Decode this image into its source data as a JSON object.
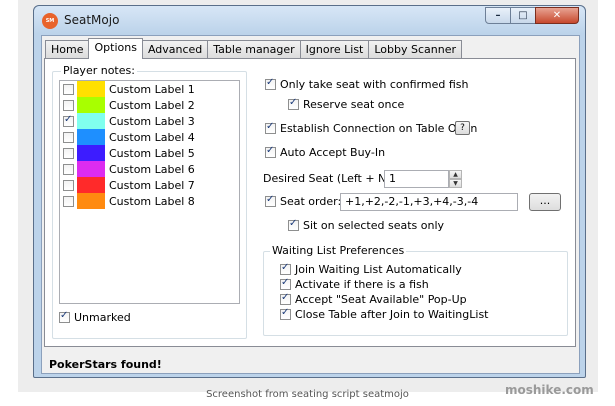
{
  "window": {
    "title": "SeatMojo",
    "icon_text": "SM"
  },
  "tabs": [
    "Home",
    "Options",
    "Advanced",
    "Table manager",
    "Ignore List",
    "Lobby Scanner"
  ],
  "player_notes": {
    "title": "Player notes:",
    "items": [
      {
        "label": "Custom Label 1",
        "color": "#ffe000",
        "checked": false
      },
      {
        "label": "Custom Label 2",
        "color": "#a8ff00",
        "checked": false
      },
      {
        "label": "Custom Label 3",
        "color": "#80ffee",
        "checked": true
      },
      {
        "label": "Custom Label 4",
        "color": "#1e8fff",
        "checked": false
      },
      {
        "label": "Custom Label 5",
        "color": "#3d1cff",
        "checked": false
      },
      {
        "label": "Custom Label 6",
        "color": "#dc2cf0",
        "checked": false
      },
      {
        "label": "Custom Label 7",
        "color": "#ff2a2a",
        "checked": false
      },
      {
        "label": "Custom Label 8",
        "color": "#ff8a10",
        "checked": false
      }
    ],
    "unmarked_label": "Unmarked",
    "unmarked_checked": true
  },
  "options": {
    "only_confirmed_fish": "Only take seat with confirmed fish",
    "reserve_once": "Reserve seat once",
    "establish_connection": "Establish Connection on Table Open",
    "help_button": "?",
    "auto_accept": "Auto Accept Buy-In",
    "desired_seat_label": "Desired Seat (Left + N):",
    "desired_seat_value": "1",
    "seat_order_label": "Seat order:",
    "seat_order_value": "+1,+2,-2,-1,+3,+4,-3,-4",
    "browse_button": "...",
    "sit_selected": "Sit on selected seats only"
  },
  "waiting_list": {
    "title": "Waiting List Preferences",
    "join_auto": "Join Waiting List Automatically",
    "activate_fish": "Activate if there is a fish",
    "accept_popup": "Accept \"Seat Available\" Pop-Up",
    "close_table": "Close Table after Join to WaitingList"
  },
  "status": "PokerStars found!",
  "caption": "Screenshot from seating script seatmojo",
  "watermark": "moshike.com"
}
